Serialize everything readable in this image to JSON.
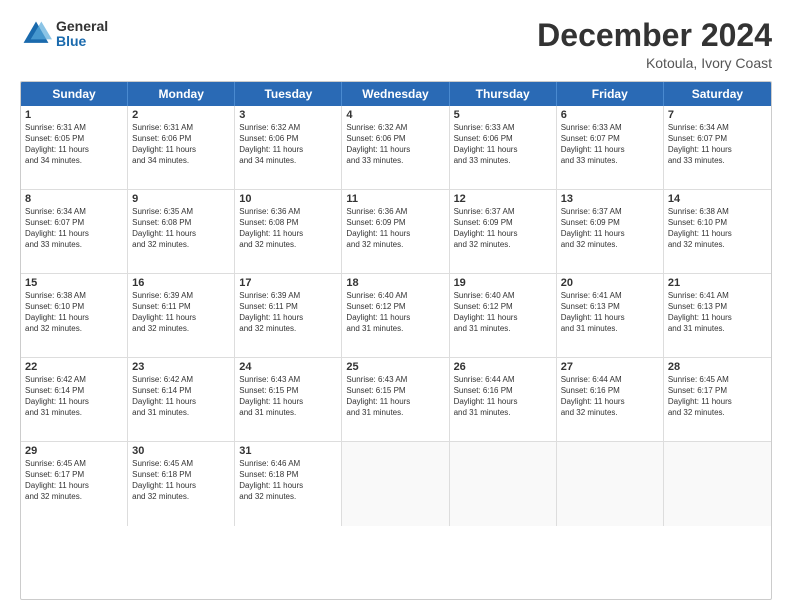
{
  "logo": {
    "general": "General",
    "blue": "Blue"
  },
  "header": {
    "month_year": "December 2024",
    "location": "Kotoula, Ivory Coast"
  },
  "weekdays": [
    "Sunday",
    "Monday",
    "Tuesday",
    "Wednesday",
    "Thursday",
    "Friday",
    "Saturday"
  ],
  "rows": [
    [
      {
        "day": "1",
        "lines": [
          "Sunrise: 6:31 AM",
          "Sunset: 6:05 PM",
          "Daylight: 11 hours",
          "and 34 minutes."
        ]
      },
      {
        "day": "2",
        "lines": [
          "Sunrise: 6:31 AM",
          "Sunset: 6:06 PM",
          "Daylight: 11 hours",
          "and 34 minutes."
        ]
      },
      {
        "day": "3",
        "lines": [
          "Sunrise: 6:32 AM",
          "Sunset: 6:06 PM",
          "Daylight: 11 hours",
          "and 34 minutes."
        ]
      },
      {
        "day": "4",
        "lines": [
          "Sunrise: 6:32 AM",
          "Sunset: 6:06 PM",
          "Daylight: 11 hours",
          "and 33 minutes."
        ]
      },
      {
        "day": "5",
        "lines": [
          "Sunrise: 6:33 AM",
          "Sunset: 6:06 PM",
          "Daylight: 11 hours",
          "and 33 minutes."
        ]
      },
      {
        "day": "6",
        "lines": [
          "Sunrise: 6:33 AM",
          "Sunset: 6:07 PM",
          "Daylight: 11 hours",
          "and 33 minutes."
        ]
      },
      {
        "day": "7",
        "lines": [
          "Sunrise: 6:34 AM",
          "Sunset: 6:07 PM",
          "Daylight: 11 hours",
          "and 33 minutes."
        ]
      }
    ],
    [
      {
        "day": "8",
        "lines": [
          "Sunrise: 6:34 AM",
          "Sunset: 6:07 PM",
          "Daylight: 11 hours",
          "and 33 minutes."
        ]
      },
      {
        "day": "9",
        "lines": [
          "Sunrise: 6:35 AM",
          "Sunset: 6:08 PM",
          "Daylight: 11 hours",
          "and 32 minutes."
        ]
      },
      {
        "day": "10",
        "lines": [
          "Sunrise: 6:36 AM",
          "Sunset: 6:08 PM",
          "Daylight: 11 hours",
          "and 32 minutes."
        ]
      },
      {
        "day": "11",
        "lines": [
          "Sunrise: 6:36 AM",
          "Sunset: 6:09 PM",
          "Daylight: 11 hours",
          "and 32 minutes."
        ]
      },
      {
        "day": "12",
        "lines": [
          "Sunrise: 6:37 AM",
          "Sunset: 6:09 PM",
          "Daylight: 11 hours",
          "and 32 minutes."
        ]
      },
      {
        "day": "13",
        "lines": [
          "Sunrise: 6:37 AM",
          "Sunset: 6:09 PM",
          "Daylight: 11 hours",
          "and 32 minutes."
        ]
      },
      {
        "day": "14",
        "lines": [
          "Sunrise: 6:38 AM",
          "Sunset: 6:10 PM",
          "Daylight: 11 hours",
          "and 32 minutes."
        ]
      }
    ],
    [
      {
        "day": "15",
        "lines": [
          "Sunrise: 6:38 AM",
          "Sunset: 6:10 PM",
          "Daylight: 11 hours",
          "and 32 minutes."
        ]
      },
      {
        "day": "16",
        "lines": [
          "Sunrise: 6:39 AM",
          "Sunset: 6:11 PM",
          "Daylight: 11 hours",
          "and 32 minutes."
        ]
      },
      {
        "day": "17",
        "lines": [
          "Sunrise: 6:39 AM",
          "Sunset: 6:11 PM",
          "Daylight: 11 hours",
          "and 32 minutes."
        ]
      },
      {
        "day": "18",
        "lines": [
          "Sunrise: 6:40 AM",
          "Sunset: 6:12 PM",
          "Daylight: 11 hours",
          "and 31 minutes."
        ]
      },
      {
        "day": "19",
        "lines": [
          "Sunrise: 6:40 AM",
          "Sunset: 6:12 PM",
          "Daylight: 11 hours",
          "and 31 minutes."
        ]
      },
      {
        "day": "20",
        "lines": [
          "Sunrise: 6:41 AM",
          "Sunset: 6:13 PM",
          "Daylight: 11 hours",
          "and 31 minutes."
        ]
      },
      {
        "day": "21",
        "lines": [
          "Sunrise: 6:41 AM",
          "Sunset: 6:13 PM",
          "Daylight: 11 hours",
          "and 31 minutes."
        ]
      }
    ],
    [
      {
        "day": "22",
        "lines": [
          "Sunrise: 6:42 AM",
          "Sunset: 6:14 PM",
          "Daylight: 11 hours",
          "and 31 minutes."
        ]
      },
      {
        "day": "23",
        "lines": [
          "Sunrise: 6:42 AM",
          "Sunset: 6:14 PM",
          "Daylight: 11 hours",
          "and 31 minutes."
        ]
      },
      {
        "day": "24",
        "lines": [
          "Sunrise: 6:43 AM",
          "Sunset: 6:15 PM",
          "Daylight: 11 hours",
          "and 31 minutes."
        ]
      },
      {
        "day": "25",
        "lines": [
          "Sunrise: 6:43 AM",
          "Sunset: 6:15 PM",
          "Daylight: 11 hours",
          "and 31 minutes."
        ]
      },
      {
        "day": "26",
        "lines": [
          "Sunrise: 6:44 AM",
          "Sunset: 6:16 PM",
          "Daylight: 11 hours",
          "and 31 minutes."
        ]
      },
      {
        "day": "27",
        "lines": [
          "Sunrise: 6:44 AM",
          "Sunset: 6:16 PM",
          "Daylight: 11 hours",
          "and 32 minutes."
        ]
      },
      {
        "day": "28",
        "lines": [
          "Sunrise: 6:45 AM",
          "Sunset: 6:17 PM",
          "Daylight: 11 hours",
          "and 32 minutes."
        ]
      }
    ],
    [
      {
        "day": "29",
        "lines": [
          "Sunrise: 6:45 AM",
          "Sunset: 6:17 PM",
          "Daylight: 11 hours",
          "and 32 minutes."
        ]
      },
      {
        "day": "30",
        "lines": [
          "Sunrise: 6:45 AM",
          "Sunset: 6:18 PM",
          "Daylight: 11 hours",
          "and 32 minutes."
        ]
      },
      {
        "day": "31",
        "lines": [
          "Sunrise: 6:46 AM",
          "Sunset: 6:18 PM",
          "Daylight: 11 hours",
          "and 32 minutes."
        ]
      },
      null,
      null,
      null,
      null
    ]
  ]
}
